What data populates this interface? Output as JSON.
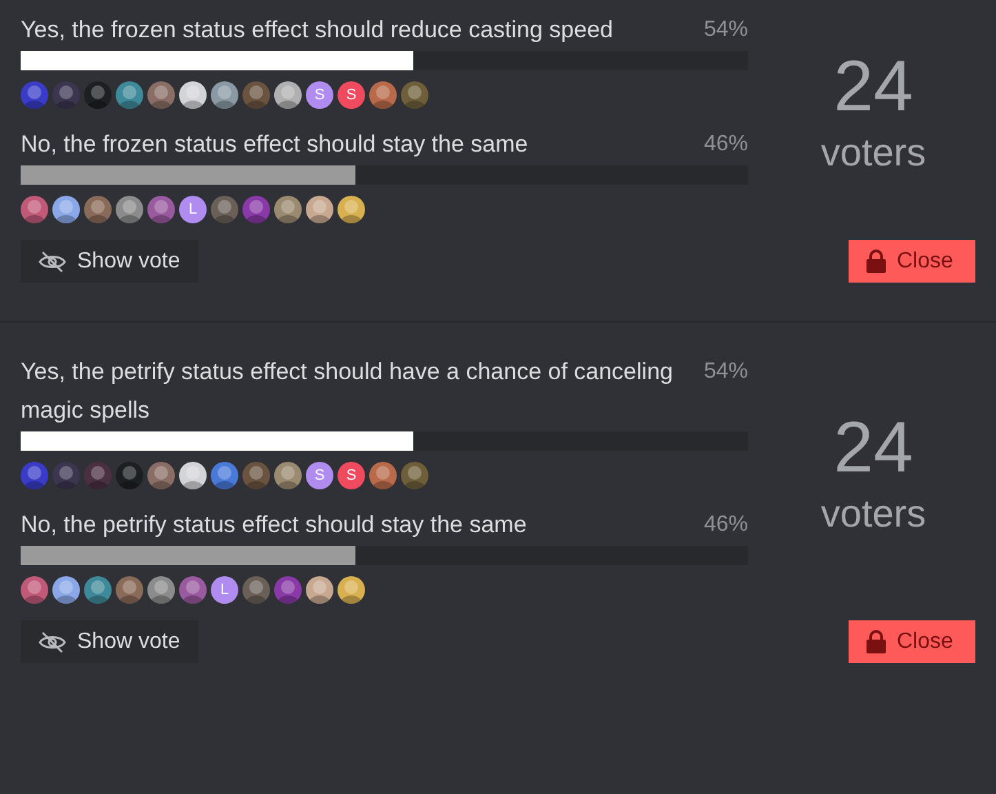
{
  "polls": [
    {
      "options": [
        {
          "text": "Yes, the frozen status effect should reduce casting speed",
          "percent": "54%",
          "level": 0.54,
          "selected": true,
          "avatars": [
            {
              "kind": "picture",
              "color": "#3a3cc8"
            },
            {
              "kind": "picture",
              "color": "#3b3550"
            },
            {
              "kind": "picture",
              "color": "#1c2022"
            },
            {
              "kind": "picture",
              "color": "#3f8a9a"
            },
            {
              "kind": "picture",
              "color": "#8a6e66"
            },
            {
              "kind": "picture",
              "color": "#d4d4d8"
            },
            {
              "kind": "picture",
              "color": "#8a9aa4"
            },
            {
              "kind": "picture",
              "color": "#6a5440"
            },
            {
              "kind": "picture",
              "color": "#b0b0b0"
            },
            {
              "kind": "letter",
              "text": "S",
              "color": "#b18cf0"
            },
            {
              "kind": "letter",
              "text": "S",
              "color": "#f04a5f"
            },
            {
              "kind": "picture",
              "color": "#b86a4a"
            },
            {
              "kind": "picture",
              "color": "#6e5f3a"
            }
          ]
        },
        {
          "text": "No, the frozen status effect should stay the same",
          "percent": "46%",
          "level": 0.46,
          "selected": false,
          "avatars": [
            {
              "kind": "picture",
              "color": "#c05a78"
            },
            {
              "kind": "picture",
              "color": "#8aa8e8"
            },
            {
              "kind": "picture",
              "color": "#8a6a58"
            },
            {
              "kind": "picture",
              "color": "#8c8c8c"
            },
            {
              "kind": "picture",
              "color": "#9a5aa0"
            },
            {
              "kind": "letter",
              "text": "L",
              "color": "#b18cf0"
            },
            {
              "kind": "picture",
              "color": "#6a6058"
            },
            {
              "kind": "picture",
              "color": "#8a3aa8"
            },
            {
              "kind": "picture",
              "color": "#9a8a70"
            },
            {
              "kind": "picture",
              "color": "#c8a890"
            },
            {
              "kind": "picture",
              "color": "#d8b050"
            }
          ]
        }
      ],
      "count": "24",
      "count_label": "voters",
      "show_vote": "Show vote",
      "close": "Close"
    },
    {
      "options": [
        {
          "text": "Yes, the petrify status effect should have a chance of canceling magic spells",
          "percent": "54%",
          "level": 0.54,
          "selected": true,
          "avatars": [
            {
              "kind": "picture",
              "color": "#3a3cc8"
            },
            {
              "kind": "picture",
              "color": "#3b3550"
            },
            {
              "kind": "picture",
              "color": "#4a3040"
            },
            {
              "kind": "picture",
              "color": "#1c2022"
            },
            {
              "kind": "picture",
              "color": "#8a6e66"
            },
            {
              "kind": "picture",
              "color": "#d4d4d8"
            },
            {
              "kind": "picture",
              "color": "#4a7ad8"
            },
            {
              "kind": "picture",
              "color": "#6a5440"
            },
            {
              "kind": "picture",
              "color": "#9a8a70"
            },
            {
              "kind": "letter",
              "text": "S",
              "color": "#b18cf0"
            },
            {
              "kind": "letter",
              "text": "S",
              "color": "#f04a5f"
            },
            {
              "kind": "picture",
              "color": "#b86a4a"
            },
            {
              "kind": "picture",
              "color": "#6e5f3a"
            }
          ]
        },
        {
          "text": "No, the petrify status effect should stay the same",
          "percent": "46%",
          "level": 0.46,
          "selected": false,
          "avatars": [
            {
              "kind": "picture",
              "color": "#c05a78"
            },
            {
              "kind": "picture",
              "color": "#8aa8e8"
            },
            {
              "kind": "picture",
              "color": "#3f8a9a"
            },
            {
              "kind": "picture",
              "color": "#8a6a58"
            },
            {
              "kind": "picture",
              "color": "#8c8c8c"
            },
            {
              "kind": "picture",
              "color": "#9a5aa0"
            },
            {
              "kind": "letter",
              "text": "L",
              "color": "#b18cf0"
            },
            {
              "kind": "picture",
              "color": "#6a6058"
            },
            {
              "kind": "picture",
              "color": "#8a3aa8"
            },
            {
              "kind": "picture",
              "color": "#c8a890"
            },
            {
              "kind": "picture",
              "color": "#d8b050"
            }
          ]
        }
      ],
      "count": "24",
      "count_label": "voters",
      "show_vote": "Show vote",
      "close": "Close"
    }
  ]
}
